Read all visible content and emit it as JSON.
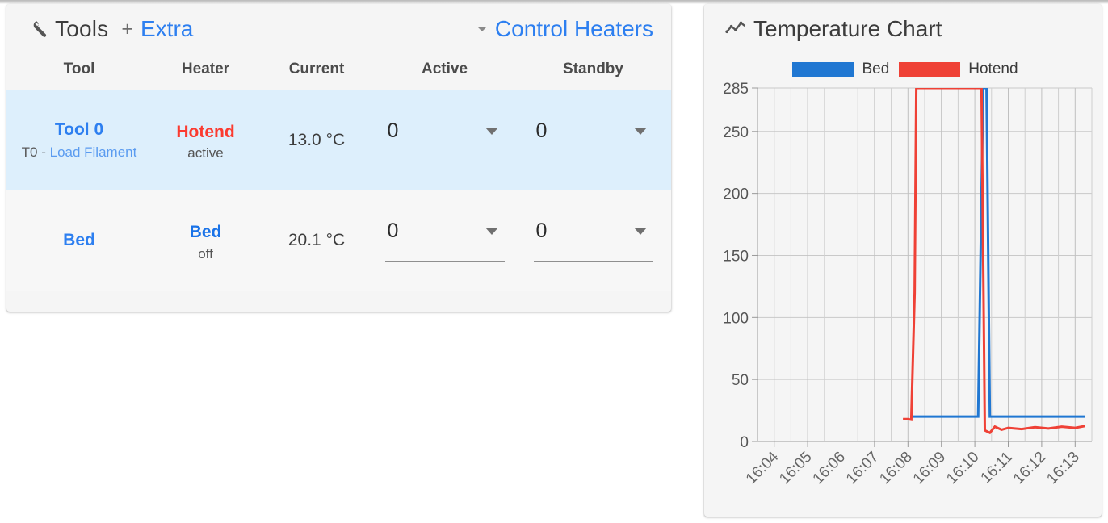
{
  "tools_panel": {
    "icon": "wrench-icon",
    "title": "Tools",
    "plus": "+",
    "extra_link": "Extra",
    "control_heaters_link": "Control Heaters",
    "caret_icon": "caret-down-icon",
    "columns": [
      "Tool",
      "Heater",
      "Current",
      "Active",
      "Standby"
    ],
    "rows": [
      {
        "tool_name": "Tool 0",
        "tool_sub_prefix": "T0 - ",
        "tool_sub_link": "Load Filament",
        "heater_name": "Hotend",
        "heater_state": "active",
        "current": "13.0 °C",
        "active_value": "0",
        "standby_value": "0",
        "selected": true
      },
      {
        "tool_name": "Bed",
        "tool_sub_prefix": "",
        "tool_sub_link": "",
        "heater_name": "Bed",
        "heater_state": "off",
        "current": "20.1 °C",
        "active_value": "0",
        "standby_value": "0",
        "selected": false
      }
    ]
  },
  "chart_panel": {
    "icon": "line-chart-icon",
    "title": "Temperature Chart"
  },
  "colors": {
    "bed": "#2077d2",
    "hotend": "#ef4136",
    "link": "#2d7ff0",
    "hotend_text": "#fb3b30",
    "selected_row": "#ddeffc",
    "card_bg": "#f5f5f5"
  },
  "chart_data": {
    "type": "line",
    "title": "Temperature Chart",
    "xlabel": "",
    "ylabel": "",
    "grid": true,
    "legend_position": "top",
    "ylim": [
      0,
      285
    ],
    "yticks": [
      0,
      50,
      100,
      150,
      200,
      250,
      285
    ],
    "xticks": [
      "16:04",
      "16:05",
      "16:06",
      "16:07",
      "16:08",
      "16:09",
      "16:10",
      "16:11",
      "16:12",
      "16:13"
    ],
    "series": [
      {
        "name": "Bed",
        "color": "#2077d2",
        "x": [
          "16:08.1",
          "16:08.4",
          "16:09.0",
          "16:09.6",
          "16:10.1",
          "16:10.25",
          "16:10.35",
          "16:10.45",
          "16:10.6",
          "16:11.2",
          "16:11.8",
          "16:12.4",
          "16:13.0",
          "16:13.3"
        ],
        "values": [
          20.1,
          20.1,
          20.1,
          20.1,
          20.1,
          285,
          285,
          20.1,
          20.1,
          20.1,
          20.1,
          20.1,
          20.1,
          20.1
        ]
      },
      {
        "name": "Hotend",
        "color": "#ef4136",
        "x": [
          "16:07.85",
          "16:08.0",
          "16:08.1",
          "16:08.2",
          "16:08.25",
          "16:10.2",
          "16:10.3",
          "16:10.45",
          "16:10.6",
          "16:10.8",
          "16:11.0",
          "16:11.4",
          "16:11.8",
          "16:12.2",
          "16:12.6",
          "16:13.0",
          "16:13.3"
        ],
        "values": [
          18.0,
          18.0,
          17.5,
          120,
          285,
          285,
          9.0,
          7.0,
          12.0,
          9.5,
          11.0,
          10.0,
          11.5,
          10.5,
          12.0,
          11.0,
          12.5
        ]
      }
    ]
  }
}
